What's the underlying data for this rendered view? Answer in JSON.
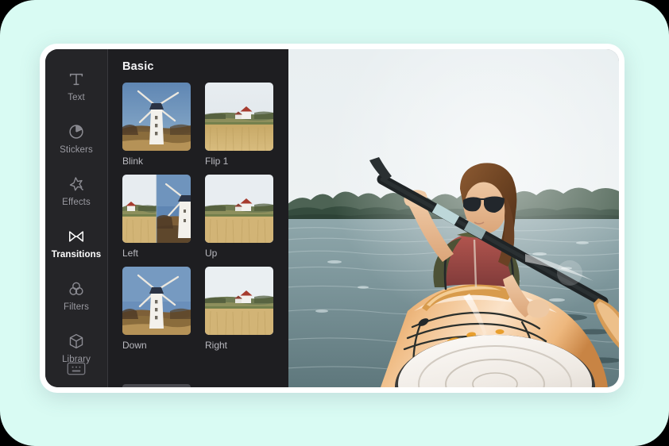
{
  "theme": {
    "page_background": "#d9fbf3",
    "card_background": "#ffffff",
    "panel_background": "#1e1e21",
    "rail_background": "#252528",
    "active_color": "#ffffff",
    "inactive_color": "#9a9aa1"
  },
  "tool_rail": {
    "items": [
      {
        "label": "Text",
        "icon": "text-icon",
        "active": false
      },
      {
        "label": "Stickers",
        "icon": "stickers-icon",
        "active": false
      },
      {
        "label": "Effects",
        "icon": "effects-icon",
        "active": false
      },
      {
        "label": "Transitions",
        "icon": "transitions-icon",
        "active": true
      },
      {
        "label": "Filters",
        "icon": "filters-icon",
        "active": false
      },
      {
        "label": "Library",
        "icon": "library-icon",
        "active": false
      }
    ],
    "bottom_icon": "keyboard-icon"
  },
  "browser": {
    "title": "Basic",
    "thumbnails": [
      {
        "label": "Blink",
        "preview": "windmill"
      },
      {
        "label": "Flip 1",
        "preview": "farmhouse"
      },
      {
        "label": "Left",
        "preview": "split-left"
      },
      {
        "label": "Up",
        "preview": "farmhouse"
      },
      {
        "label": "Down",
        "preview": "windmill"
      },
      {
        "label": "Right",
        "preview": "farmhouse"
      }
    ]
  },
  "preview": {
    "scene": "woman-kayaking-on-lake"
  }
}
